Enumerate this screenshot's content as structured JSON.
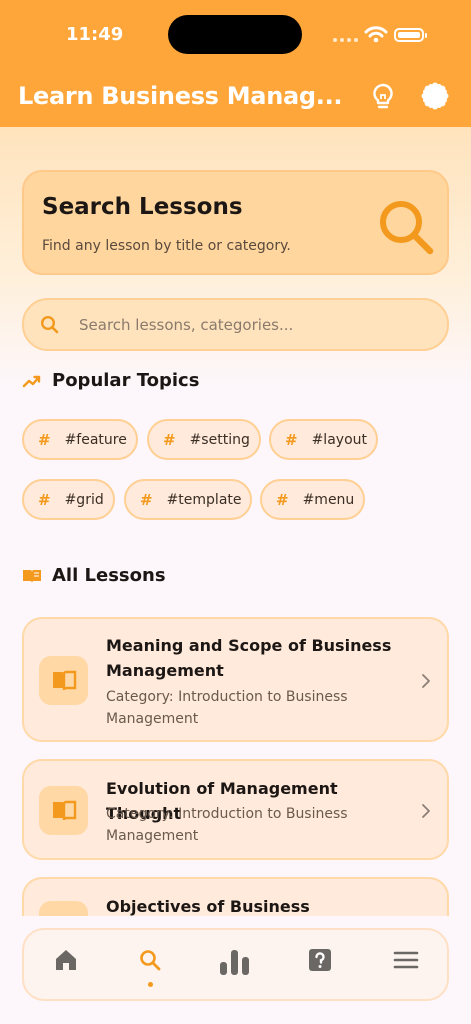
{
  "status_bar": {
    "time": "11:49"
  },
  "app_bar": {
    "title": "Learn Business Manag...",
    "icons": [
      "lightbulb-icon",
      "settings-gear-icon"
    ]
  },
  "search_card": {
    "title": "Search Lessons",
    "subtitle": "Find any lesson by title or category.",
    "icon": "magnifier-icon"
  },
  "search": {
    "placeholder": "Search lessons, categories...",
    "value": ""
  },
  "popular": {
    "heading": "Popular Topics",
    "icon": "trending-up-icon",
    "tags": [
      {
        "hash": "#",
        "label": "#feature"
      },
      {
        "hash": "#",
        "label": "#setting"
      },
      {
        "hash": "#",
        "label": "#layout"
      },
      {
        "hash": "#",
        "label": "#grid"
      },
      {
        "hash": "#",
        "label": "#template"
      },
      {
        "hash": "#",
        "label": "#menu"
      }
    ]
  },
  "lessons_section": {
    "heading": "All Lessons",
    "icon": "open-book-icon",
    "items": [
      {
        "title": "Meaning and Scope of Business Management",
        "category": "Category: Introduction to Business Management"
      },
      {
        "title": "Evolution of Management Thought",
        "category": "Category: Introduction to Business Management"
      },
      {
        "title": "Objectives of Business Organizations",
        "category": ""
      }
    ]
  },
  "bottom_nav": {
    "items": [
      "home-icon",
      "search-icon",
      "stats-icon",
      "help-icon",
      "menu-icon"
    ],
    "active": "search-icon"
  },
  "colors": {
    "accent": "#fea63a",
    "icon_orange": "#f39a1e",
    "card_bg": "#ffeadb"
  }
}
